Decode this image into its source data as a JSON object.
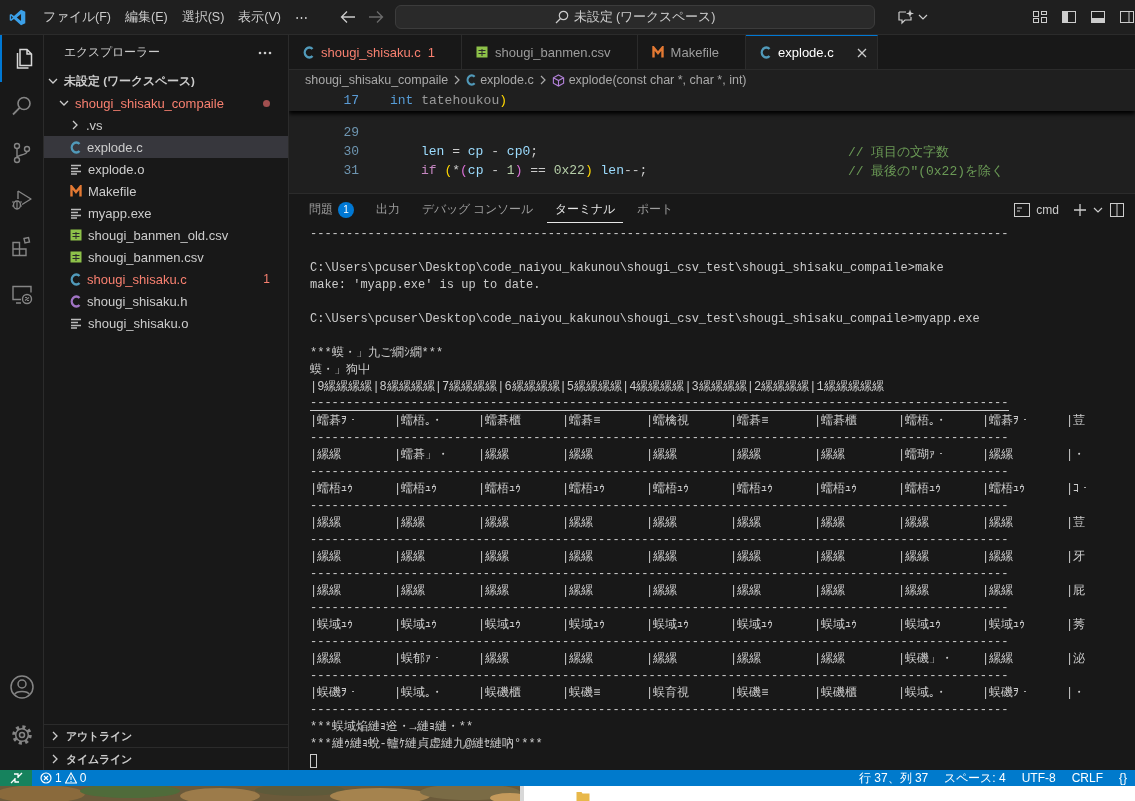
{
  "title_bar": {
    "menus": [
      "ファイル(F)",
      "編集(E)",
      "選択(S)",
      "表示(V)",
      "⋯"
    ],
    "search": "未設定 (ワークスペース)"
  },
  "activity_bar": {
    "items": [
      {
        "kind": "explorer",
        "selected": true
      },
      {
        "kind": "search",
        "selected": false
      },
      {
        "kind": "source_control",
        "selected": false
      },
      {
        "kind": "run_debug",
        "selected": false
      },
      {
        "kind": "extensions",
        "selected": false
      },
      {
        "kind": "remote",
        "selected": false
      }
    ]
  },
  "explorer": {
    "title": "エクスプローラー",
    "workspace": {
      "label": "未設定 (ワークスペース)",
      "expanded": true,
      "children": [
        {
          "label": "shougi_shisaku_compaile",
          "kind": "folder",
          "expanded": true,
          "error": true,
          "selected": false,
          "children": [
            {
              "label": ".vs",
              "kind": "folder",
              "expanded": false,
              "error": false,
              "selected": false
            },
            {
              "label": "explode.c",
              "kind": "c",
              "error": false,
              "selected": true
            },
            {
              "label": "explode.o",
              "kind": "file",
              "error": false,
              "selected": false
            },
            {
              "label": "Makefile",
              "kind": "make",
              "error": false,
              "selected": false
            },
            {
              "label": "myapp.exe",
              "kind": "file",
              "error": false,
              "selected": false
            },
            {
              "label": "shougi_banmen_old.csv",
              "kind": "csv",
              "error": false,
              "selected": false
            },
            {
              "label": "shougi_banmen.csv",
              "kind": "csv",
              "error": false,
              "selected": false
            },
            {
              "label": "shougi_shisaku.c",
              "kind": "c",
              "error": true,
              "problems": "1",
              "selected": false
            },
            {
              "label": "shougi_shisaku.h",
              "kind": "h",
              "error": false,
              "selected": false
            },
            {
              "label": "shougi_shisaku.o",
              "kind": "file",
              "error": false,
              "selected": false
            }
          ]
        }
      ]
    },
    "sections": [
      {
        "label": "アウトライン",
        "expanded": false
      },
      {
        "label": "タイムライン",
        "expanded": false
      }
    ]
  },
  "tabs": [
    {
      "label": "shougi_shisaku.c",
      "kind": "c",
      "error": true,
      "problems": "1",
      "selected": false
    },
    {
      "label": "shougi_banmen.csv",
      "kind": "csv",
      "error": false,
      "selected": false
    },
    {
      "label": "Makefile",
      "kind": "make",
      "error": false,
      "selected": false
    },
    {
      "label": "explode.c",
      "kind": "c",
      "error": false,
      "selected": true
    }
  ],
  "breadcrumb": [
    {
      "label": "shougi_shisaku_compaile",
      "kind": "folder"
    },
    {
      "label": "explode.c",
      "kind": "c"
    },
    {
      "label": "explode(const char *, char *, int)",
      "kind": "function"
    }
  ],
  "editor": {
    "sticky": {
      "number": "17",
      "segments": [
        {
          "text": "int",
          "kind": "type"
        },
        {
          "text": " tatehoukou",
          "kind": "dim"
        },
        {
          "text": ")",
          "kind": "bracket1"
        }
      ]
    },
    "lines": [
      {
        "number": "29"
      },
      {
        "number": "30",
        "segments": [
          {
            "text": "len",
            "kind": "var"
          },
          {
            "text": " = ",
            "kind": "plain"
          },
          {
            "text": "cp",
            "kind": "var"
          },
          {
            "text": " - ",
            "kind": "plain"
          },
          {
            "text": "cp0",
            "kind": "var"
          },
          {
            "text": ";",
            "kind": "plain"
          }
        ],
        "comment": "// 項目の文字数"
      },
      {
        "number": "31",
        "segments": [
          {
            "text": "if",
            "kind": "control"
          },
          {
            "text": " (",
            "kind": "bracket1"
          },
          {
            "text": "*",
            "kind": "plain"
          },
          {
            "text": "(",
            "kind": "bracket2"
          },
          {
            "text": "cp",
            "kind": "var"
          },
          {
            "text": " - ",
            "kind": "plain"
          },
          {
            "text": "1",
            "kind": "num"
          },
          {
            "text": ")",
            "kind": "bracket2"
          },
          {
            "text": " == ",
            "kind": "plain"
          },
          {
            "text": "0x22",
            "kind": "num"
          },
          {
            "text": ")",
            "kind": "bracket1"
          },
          {
            "text": " len",
            "kind": "var"
          },
          {
            "text": "--;",
            "kind": "plain"
          }
        ],
        "comment": "// 最後の\"(0x22)を除く"
      }
    ]
  },
  "panel": {
    "tabs": [
      {
        "label": "問題",
        "badge": "1",
        "selected": false
      },
      {
        "label": "出力",
        "selected": false
      },
      {
        "label": "デバッグ コンソール",
        "selected": false
      },
      {
        "label": "ターミナル",
        "selected": true
      },
      {
        "label": "ポート",
        "selected": false
      }
    ],
    "shell": "cmd"
  },
  "terminal": {
    "lines": [
      {
        "kind": "rule",
        "text": "-------------------------------------------------------------------------------------------------"
      },
      {
        "kind": "blank"
      },
      {
        "kind": "text",
        "text": "C:\\Users\\pcuser\\Desktop\\code_naiyou_kakunou\\shougi_csv_test\\shougi_shisaku_compaile>make"
      },
      {
        "kind": "text",
        "text": "make: 'myapp.exe' is up to date."
      },
      {
        "kind": "blank"
      },
      {
        "kind": "text",
        "text": "C:\\Users\\pcuser\\Desktop\\code_naiyou_kakunou\\shougi_csv_test\\shougi_shisaku_compaile>myapp.exe"
      },
      {
        "kind": "blank"
      },
      {
        "kind": "text",
        "text": "***蟆・」九ご繝ｼ繝***"
      },
      {
        "kind": "text",
        "text": "蟆・」狗屮"
      },
      {
        "kind": "text",
        "text": "|9縲縲縲縲|8縲縲縲縲|7縲縲縲縲|6縲縲縲縲|5縲縲縲縲|4縲縲縲縲|3縲縲縲縲|2縲縲縲縲|1縲縲縲縲縲"
      },
      {
        "kind": "rule_double",
        "text": "-------------------------------------------------------------------------------------------------"
      },
      {
        "kind": "row",
        "cells": [
          "|蠕碁ｦ・",
          "|蠕梧｡・",
          "|蠕碁櫃",
          "|蠕碁≡",
          "|蠕檎視",
          "|蠕碁≡",
          "|蠕碁櫃",
          "|蠕梧｡・",
          "|蠕碁ｦ・",
          "|荳"
        ]
      },
      {
        "kind": "rule",
        "text": "-------------------------------------------------------------------------------------------------"
      },
      {
        "kind": "row",
        "cells": [
          "|縲縲",
          "|蠕碁」・",
          "|縲縲",
          "|縲縲",
          "|縲縲",
          "|縲縲",
          "|縲縲",
          "|蠕瑚ｧ・",
          "|縲縲",
          "|・"
        ]
      },
      {
        "kind": "rule",
        "text": "-------------------------------------------------------------------------------------------------"
      },
      {
        "kind": "row",
        "cells": [
          "|蠕梧ｭｩ",
          "|蠕梧ｭｩ",
          "|蠕梧ｭｩ",
          "|蠕梧ｭｩ",
          "|蠕梧ｭｩ",
          "|蠕梧ｭｩ",
          "|蠕梧ｭｩ",
          "|蠕梧ｭｩ",
          "|蠕梧ｭｩ",
          "|ｺ・"
        ]
      },
      {
        "kind": "rule",
        "text": "-------------------------------------------------------------------------------------------------"
      },
      {
        "kind": "row",
        "cells": [
          "|縲縲",
          "|縲縲",
          "|縲縲",
          "|縲縲",
          "|縲縲",
          "|縲縲",
          "|縲縲",
          "|縲縲",
          "|縲縲",
          "|荳"
        ]
      },
      {
        "kind": "rule",
        "text": "-------------------------------------------------------------------------------------------------"
      },
      {
        "kind": "row",
        "cells": [
          "|縲縲",
          "|縲縲",
          "|縲縲",
          "|縲縲",
          "|縲縲",
          "|縲縲",
          "|縲縲",
          "|縲縲",
          "|縲縲",
          "|牙"
        ]
      },
      {
        "kind": "rule",
        "text": "-------------------------------------------------------------------------------------------------"
      },
      {
        "kind": "row",
        "cells": [
          "|縲縲",
          "|縲縲",
          "|縲縲",
          "|縲縲",
          "|縲縲",
          "|縲縲",
          "|縲縲",
          "|縲縲",
          "|縲縲",
          "|屁"
        ]
      },
      {
        "kind": "rule",
        "text": "-------------------------------------------------------------------------------------------------"
      },
      {
        "kind": "row",
        "cells": [
          "|蜈域ｭｩ",
          "|蜈域ｭｩ",
          "|蜈域ｭｩ",
          "|蜈域ｭｩ",
          "|蜈域ｭｩ",
          "|蜈域ｭｩ",
          "|蜈域ｭｩ",
          "|蜈域ｭｩ",
          "|蜈域ｭｩ",
          "|莠"
        ]
      },
      {
        "kind": "rule",
        "text": "-------------------------------------------------------------------------------------------------"
      },
      {
        "kind": "row",
        "cells": [
          "|縲縲",
          "|蜈郁ｧ・",
          "|縲縲",
          "|縲縲",
          "|縲縲",
          "|縲縲",
          "|縲縲",
          "|蜈磯」・",
          "|縲縲",
          "|泌"
        ]
      },
      {
        "kind": "rule",
        "text": "-------------------------------------------------------------------------------------------------"
      },
      {
        "kind": "row",
        "cells": [
          "|蜈磯ｦ・",
          "|蜈域｡・",
          "|蜈磯櫃",
          "|蜈磯≡",
          "|蜈育視",
          "|蜈磯≡",
          "|蜈磯櫃",
          "|蜈域｡・",
          "|蜈磯ｦ・",
          "|・"
        ]
      },
      {
        "kind": "rule",
        "text": "-------------------------------------------------------------------------------------------------"
      },
      {
        "kind": "text",
        "text": "***蜈域焔縺ｮ逧・→縺ｮ縺・**"
      },
      {
        "kind": "text",
        "text": "***縺ｩ縺ｮ蛻-轤ｹ縺貞虚縺九@縺ｾ縺吶°***"
      },
      {
        "kind": "cursor"
      }
    ]
  },
  "status_bar": {
    "errors": "1",
    "warnings": "0",
    "items": [
      "行 37、列 37",
      "スペース: 4",
      "UTF-8",
      "CRLF",
      "{}"
    ]
  }
}
